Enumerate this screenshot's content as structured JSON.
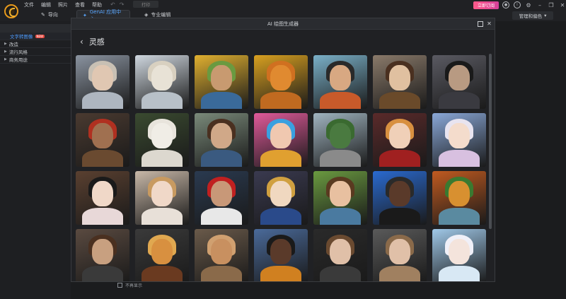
{
  "menu": [
    "文件",
    "编辑",
    "照片",
    "查看",
    "帮助"
  ],
  "toolbar": {
    "undo": "↶",
    "redo": "↷",
    "print": "打印"
  },
  "tabs": {
    "guide": "导向",
    "genai": "GenAI 应用中心",
    "pro": "专业编辑"
  },
  "subscribe": "立即订阅",
  "manage": "管理和偏色",
  "left_panel": {
    "items": [
      {
        "label": "文字转图像",
        "badge": "NEW",
        "active": true
      },
      {
        "label": "改造",
        "active": false
      },
      {
        "label": "流行风格",
        "active": false
      },
      {
        "label": "商务用途",
        "active": false
      }
    ]
  },
  "bottom_checkbox": "不再显示",
  "modal": {
    "title": "AI 绘图生成器",
    "section": "灵感"
  },
  "tiles": [
    {
      "bg": "#8a93a0",
      "face": "#e0c7b2",
      "hair": "#c8c0b4",
      "body": "#aeb6c0"
    },
    {
      "bg": "#cfd7df",
      "face": "#e8e2d6",
      "hair": "#d8d0c0",
      "body": "#b8c0c8"
    },
    {
      "bg": "#e0b030",
      "face": "#c89a70",
      "hair": "#6a9a40",
      "body": "#3a6a9a"
    },
    {
      "bg": "#d8a020",
      "face": "#e08a30",
      "hair": "#d07020",
      "body": "#c06a20"
    },
    {
      "bg": "#7ab0c8",
      "face": "#d8a882",
      "hair": "#2a2a2a",
      "body": "#c85a2a"
    },
    {
      "bg": "#8a7a6a",
      "face": "#e0c0a0",
      "hair": "#4a3020",
      "body": "#6a4a2a"
    },
    {
      "bg": "#5a5a62",
      "face": "#b89a82",
      "hair": "#1a1a1a",
      "body": "#3a3a40"
    },
    {
      "bg": "#4a3a30",
      "face": "#a07050",
      "hair": "#b03020",
      "body": "#6a4a30"
    },
    {
      "bg": "#3a4a30",
      "face": "#f0ede6",
      "hair": "#e8e4dc",
      "body": "#dcd8cf"
    },
    {
      "bg": "#7a8a7a",
      "face": "#d0a888",
      "hair": "#4a3020",
      "body": "#3a5a80"
    },
    {
      "bg": "#e05a9a",
      "face": "#f0c8b0",
      "hair": "#3aa0e0",
      "body": "#e0a030"
    },
    {
      "bg": "#a0b4c0",
      "face": "#4a7a40",
      "hair": "#3a6a30",
      "body": "#8a8a8a"
    },
    {
      "bg": "#5a2a2a",
      "face": "#f0d0b8",
      "hair": "#d89040",
      "body": "#a02020"
    },
    {
      "bg": "#8aa8d8",
      "face": "#f4dccc",
      "hair": "#e8e4f0",
      "body": "#d8c0e0"
    },
    {
      "bg": "#5a4030",
      "face": "#f0d8c8",
      "hair": "#1a1a1a",
      "body": "#e8d8d8"
    },
    {
      "bg": "#c8b8a8",
      "face": "#f0d8c8",
      "hair": "#c89a60",
      "body": "#e8e0d8"
    },
    {
      "bg": "#2a3a50",
      "face": "#c89878",
      "hair": "#c02020",
      "body": "#e8e8e8"
    },
    {
      "bg": "#3a3a50",
      "face": "#f0d8c0",
      "hair": "#d0a040",
      "body": "#2a4a8a"
    },
    {
      "bg": "#6a9a40",
      "face": "#e8c0a0",
      "hair": "#5a3a20",
      "body": "#4a7aa0"
    },
    {
      "bg": "#2a6ad0",
      "face": "#5a3a2a",
      "hair": "#2a2a2a",
      "body": "#1a1a1a"
    },
    {
      "bg": "#c05a20",
      "face": "#d89030",
      "hair": "#3a7a30",
      "body": "#5a8aa0"
    },
    {
      "bg": "#5a4a40",
      "face": "#c8a080",
      "hair": "#4a3020",
      "body": "#3a3a3a"
    },
    {
      "bg": "#3a3a3a",
      "face": "#d89040",
      "hair": "#e0a850",
      "body": "#6a3a20"
    },
    {
      "bg": "#6a5a4a",
      "face": "#c89060",
      "hair": "#d0a070",
      "body": "#8a6a4a"
    },
    {
      "bg": "#4a6a9a",
      "face": "#5a3a2a",
      "hair": "#1a1a1a",
      "body": "#d08020"
    },
    {
      "bg": "#2a2a2a",
      "face": "#e0c0a8",
      "hair": "#6a4a30",
      "body": "#3a3a3a"
    },
    {
      "bg": "#5a5a5a",
      "face": "#e0c0a8",
      "hair": "#8a6a4a",
      "body": "#a08060"
    },
    {
      "bg": "#a0c8e8",
      "face": "#f4e4dc",
      "hair": "#f0f0f8",
      "body": "#d8e8f4"
    }
  ]
}
